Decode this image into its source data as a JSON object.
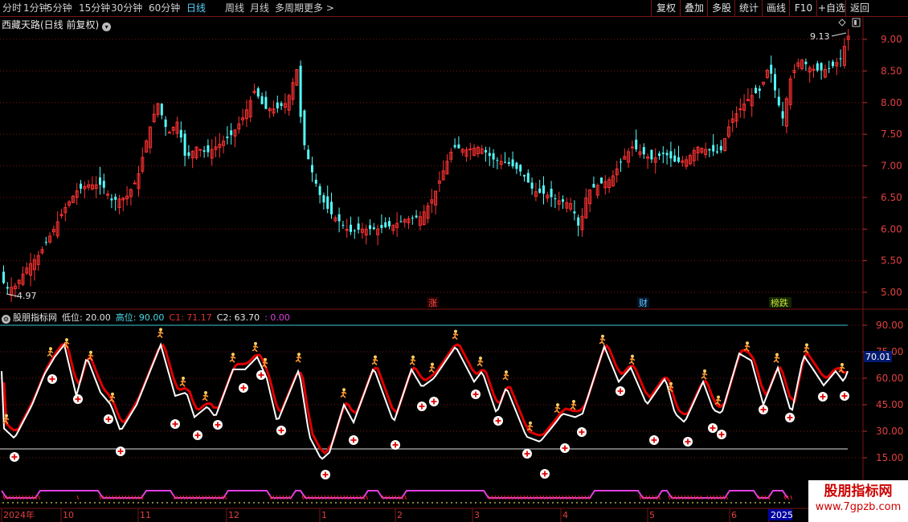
{
  "toolbar": {
    "left": [
      "分时",
      "1分钟",
      "5分钟",
      "15分钟",
      "30分钟",
      "60分钟",
      "日线",
      "周线",
      "月线",
      "多周期",
      "更多 >"
    ],
    "active": "日线",
    "right": [
      "复权",
      "叠加",
      "多股",
      "统计",
      "画线",
      "F10",
      "+自选",
      "返回"
    ]
  },
  "stock": {
    "title": "西藏天路(日线 前复权)"
  },
  "price_axis": {
    "ticks": [
      "9.00",
      "8.50",
      "8.00",
      "7.50",
      "7.00",
      "6.50",
      "6.00",
      "5.50",
      "5.00"
    ]
  },
  "price_markers": {
    "high": "9.13",
    "low": "4.97"
  },
  "events": [
    "涨",
    "财",
    "榜跌"
  ],
  "indicator": {
    "name": "股朋指标网",
    "params": [
      {
        "label": "低位:",
        "value": "20.00",
        "color": "#e0e0e0"
      },
      {
        "label": "高位:",
        "value": "90.00",
        "color": "#4cd8e6"
      },
      {
        "label": "C1:",
        "value": "71.17",
        "color": "#e03030"
      },
      {
        "label": "C2:",
        "value": "63.70",
        "color": "#e8e8e8"
      },
      {
        "label": ":",
        "value": "0.00",
        "color": "#e040e0"
      }
    ],
    "axis_ticks": [
      "90.00",
      "75.00",
      "60.00",
      "45.00",
      "30.00",
      "15.00"
    ],
    "current_value": "70.01"
  },
  "time_axis": [
    "2024年",
    "10",
    "11",
    "12",
    "1",
    "2",
    "3",
    "4",
    "5",
    "6",
    "2025"
  ],
  "watermark": {
    "title": "股朋指标网",
    "url": "www.7gpzb.com"
  },
  "colors": {
    "up": "#ff3232",
    "down": "#54fcfc",
    "grid": "#7a1414",
    "c1": "#e00000",
    "c2": "#ffffff",
    "band": "#e040e0"
  },
  "icons": [
    "expand-icon",
    "diamond-icon",
    "settings-icon",
    "chevron-down-icon",
    "running-man-icon",
    "plus-circle-icon"
  ]
}
